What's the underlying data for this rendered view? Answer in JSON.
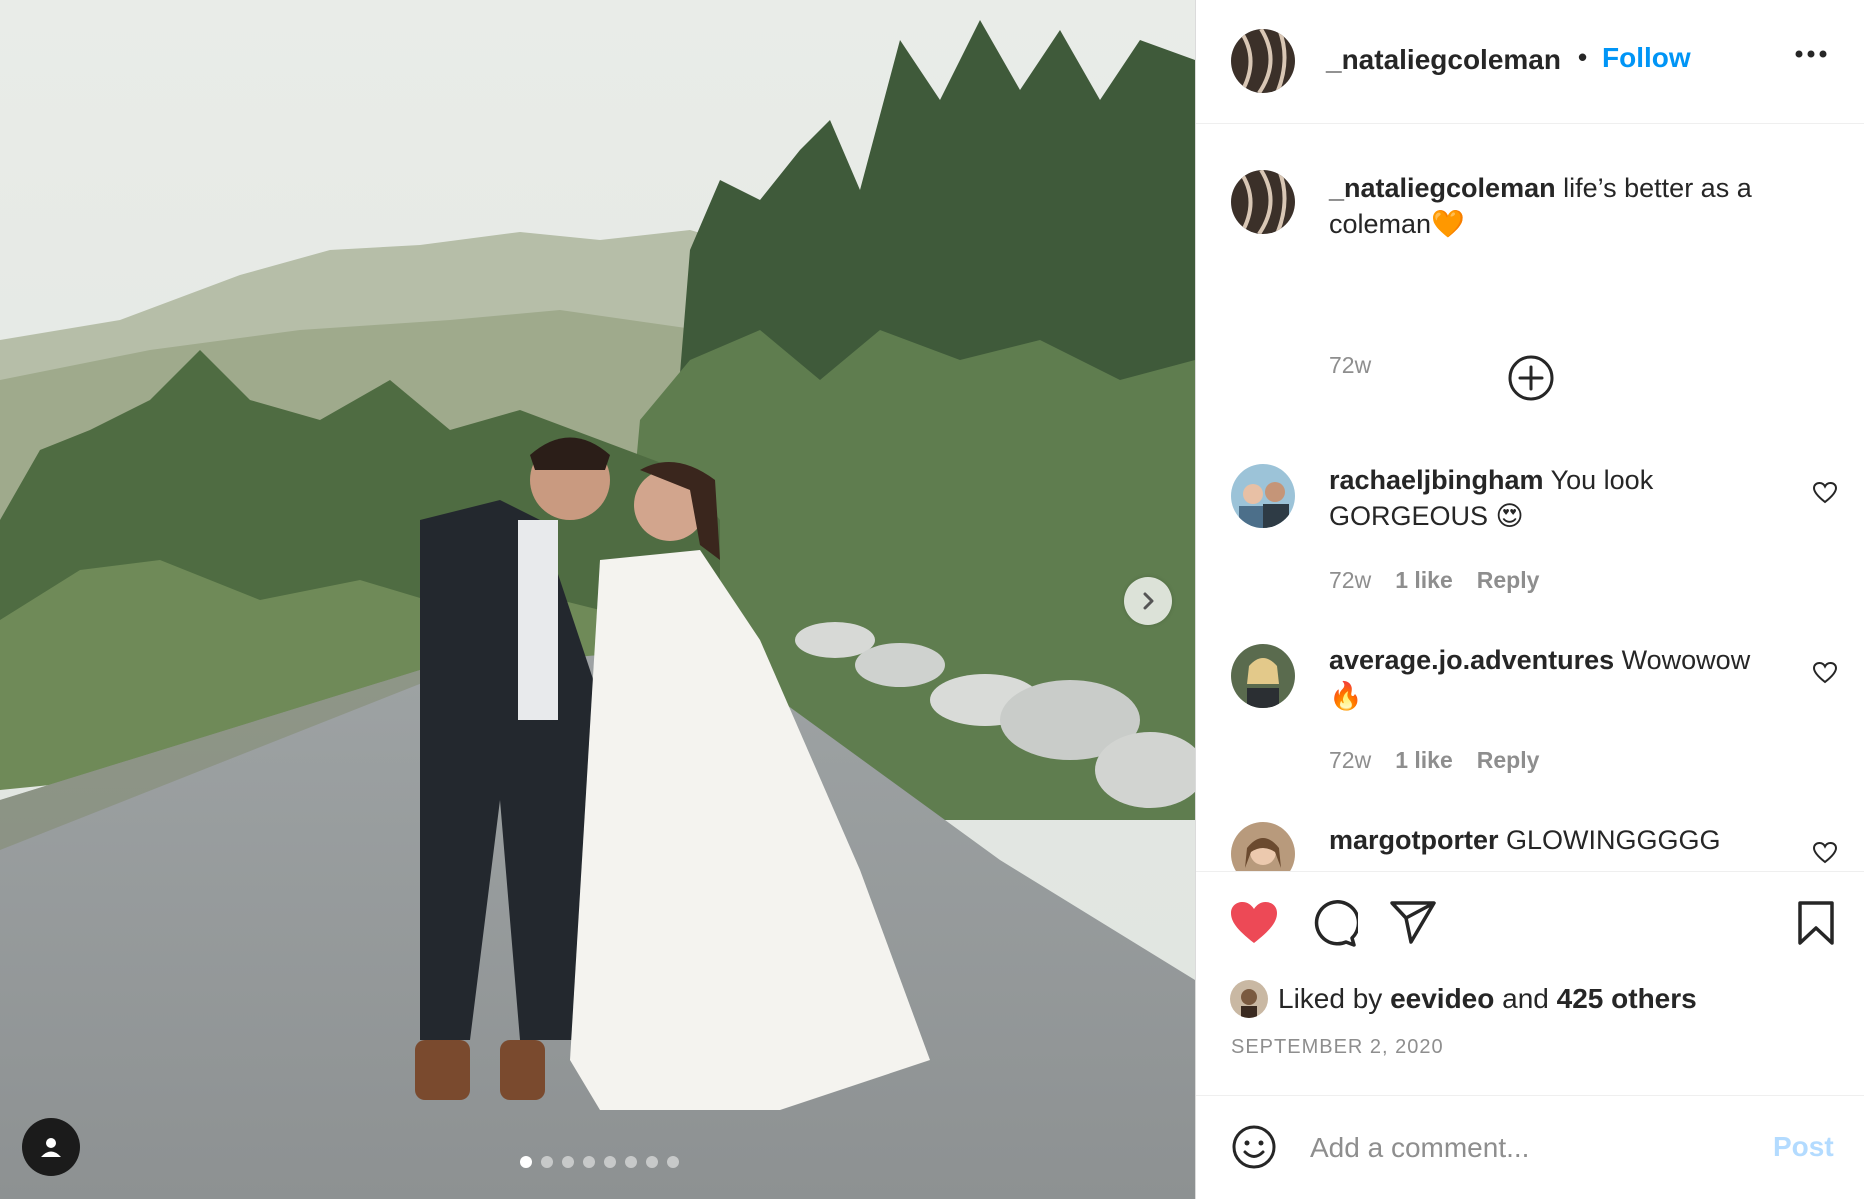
{
  "post": {
    "username": "_nataliegcoleman",
    "follow_label": "Follow",
    "separator": "•",
    "image_alt": "Bride and groom walking on a mountain road",
    "carousel": {
      "total": 8,
      "current": 1
    }
  },
  "caption": {
    "username": "_nataliegcoleman",
    "text_line1": "life’s better as a",
    "text_line2": "coleman",
    "emoji": "🧡",
    "time": "72w"
  },
  "comments": [
    {
      "username": "rachaeljbingham",
      "text_line1": "You look",
      "text_line2": "GORGEOUS",
      "emoji": "😍",
      "time": "72w",
      "likes": "1 like",
      "reply": "Reply"
    },
    {
      "username": "average.jo.adventures",
      "text_line1": "Wowowow",
      "text_line2": "",
      "emoji": "🔥",
      "time": "72w",
      "likes": "1 like",
      "reply": "Reply"
    },
    {
      "username": "margotporter",
      "text_line1": "GLOWINGGGGG"
    }
  ],
  "likes": {
    "prefix": "Liked by",
    "user": "eevideo",
    "middle": "and",
    "others": "425 others"
  },
  "date": "SEPTEMBER 2, 2020",
  "add_comment": {
    "placeholder": "Add a comment...",
    "post_label": "Post"
  },
  "colors": {
    "link": "#0095f6",
    "like_red": "#ed4956",
    "post_disabled": "#b3dbff",
    "secondary_text": "#8e8e8e"
  },
  "icons": [
    "next-arrow-icon",
    "user-tag-icon",
    "more-options-icon",
    "add-circle-icon",
    "heart-outline-icon",
    "heart-filled-icon",
    "comment-icon",
    "share-icon",
    "bookmark-icon",
    "emoji-icon"
  ]
}
